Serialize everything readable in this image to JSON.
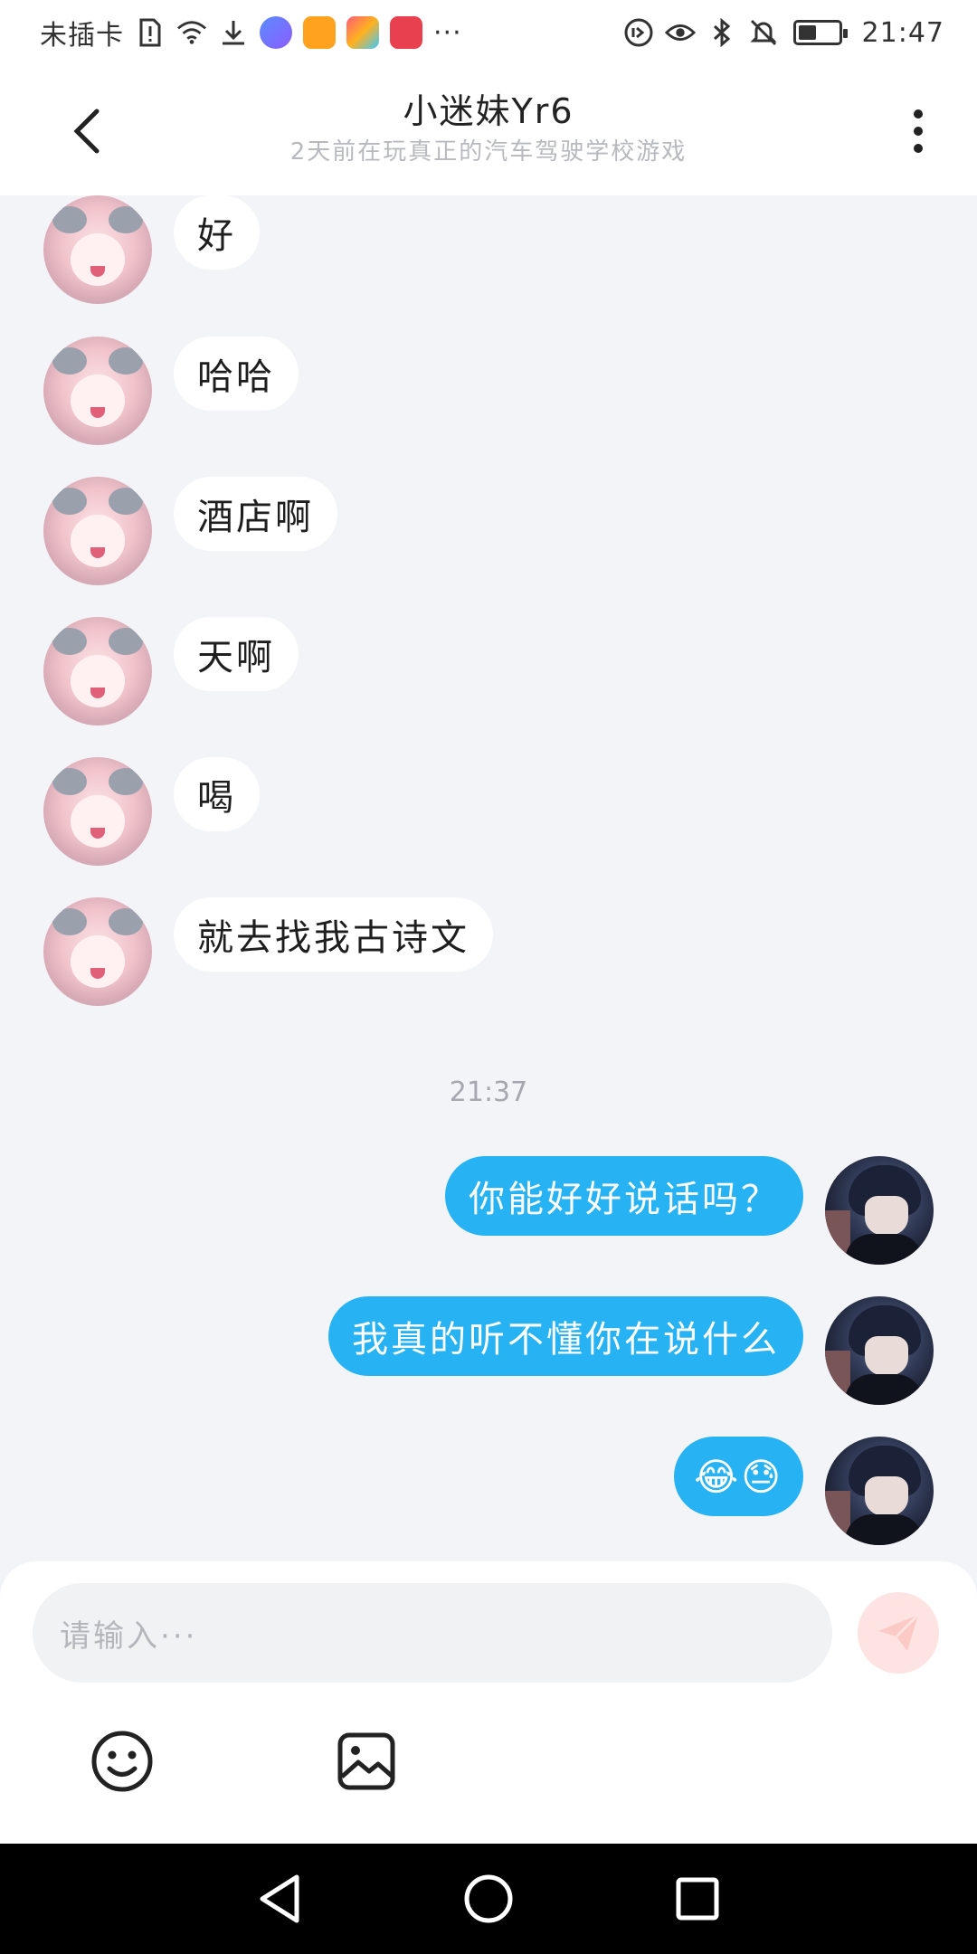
{
  "status_bar": {
    "carrier": "未插卡",
    "time": "21:47",
    "more": "···",
    "icons": [
      "sim-alert-icon",
      "wifi-icon",
      "download-icon",
      "music-app-icon",
      "orange-app-icon",
      "theme-app-icon",
      "huawei-app-icon",
      "data-saver-icon",
      "eye-comfort-icon",
      "bluetooth-icon",
      "mute-icon",
      "battery-icon"
    ],
    "battery_level": 0.45
  },
  "header": {
    "title": "小迷妹Yr6",
    "subtitle": "2天前在玩真正的汽车驾驶学校游戏",
    "back_icon": "chevron-left-icon",
    "more_icon": "more-vertical-icon"
  },
  "messages": [
    {
      "side": "left",
      "text": "好"
    },
    {
      "side": "left",
      "text": "哈哈"
    },
    {
      "side": "left",
      "text": "酒店啊"
    },
    {
      "side": "left",
      "text": "天啊"
    },
    {
      "side": "left",
      "text": "喝"
    },
    {
      "side": "left",
      "text": "就去找我古诗文"
    },
    {
      "side": "right",
      "text": "你能好好说话吗？"
    },
    {
      "side": "right",
      "text": "我真的听不懂你在说什么"
    },
    {
      "side": "right",
      "text": "😂😓"
    }
  ],
  "timestamp": "21:37",
  "input": {
    "placeholder": "请输入···",
    "send_icon": "paper-plane-icon",
    "emoji_icon": "smiley-icon",
    "image_icon": "image-icon"
  },
  "nav": {
    "icons": [
      "back-triangle-icon",
      "home-circle-icon",
      "recents-square-icon"
    ]
  },
  "colors": {
    "sent_bubble": "#27b2f3",
    "received_bubble": "#ffffff",
    "chat_background": "#f3f4f8",
    "send_button": "#fde3e1"
  }
}
